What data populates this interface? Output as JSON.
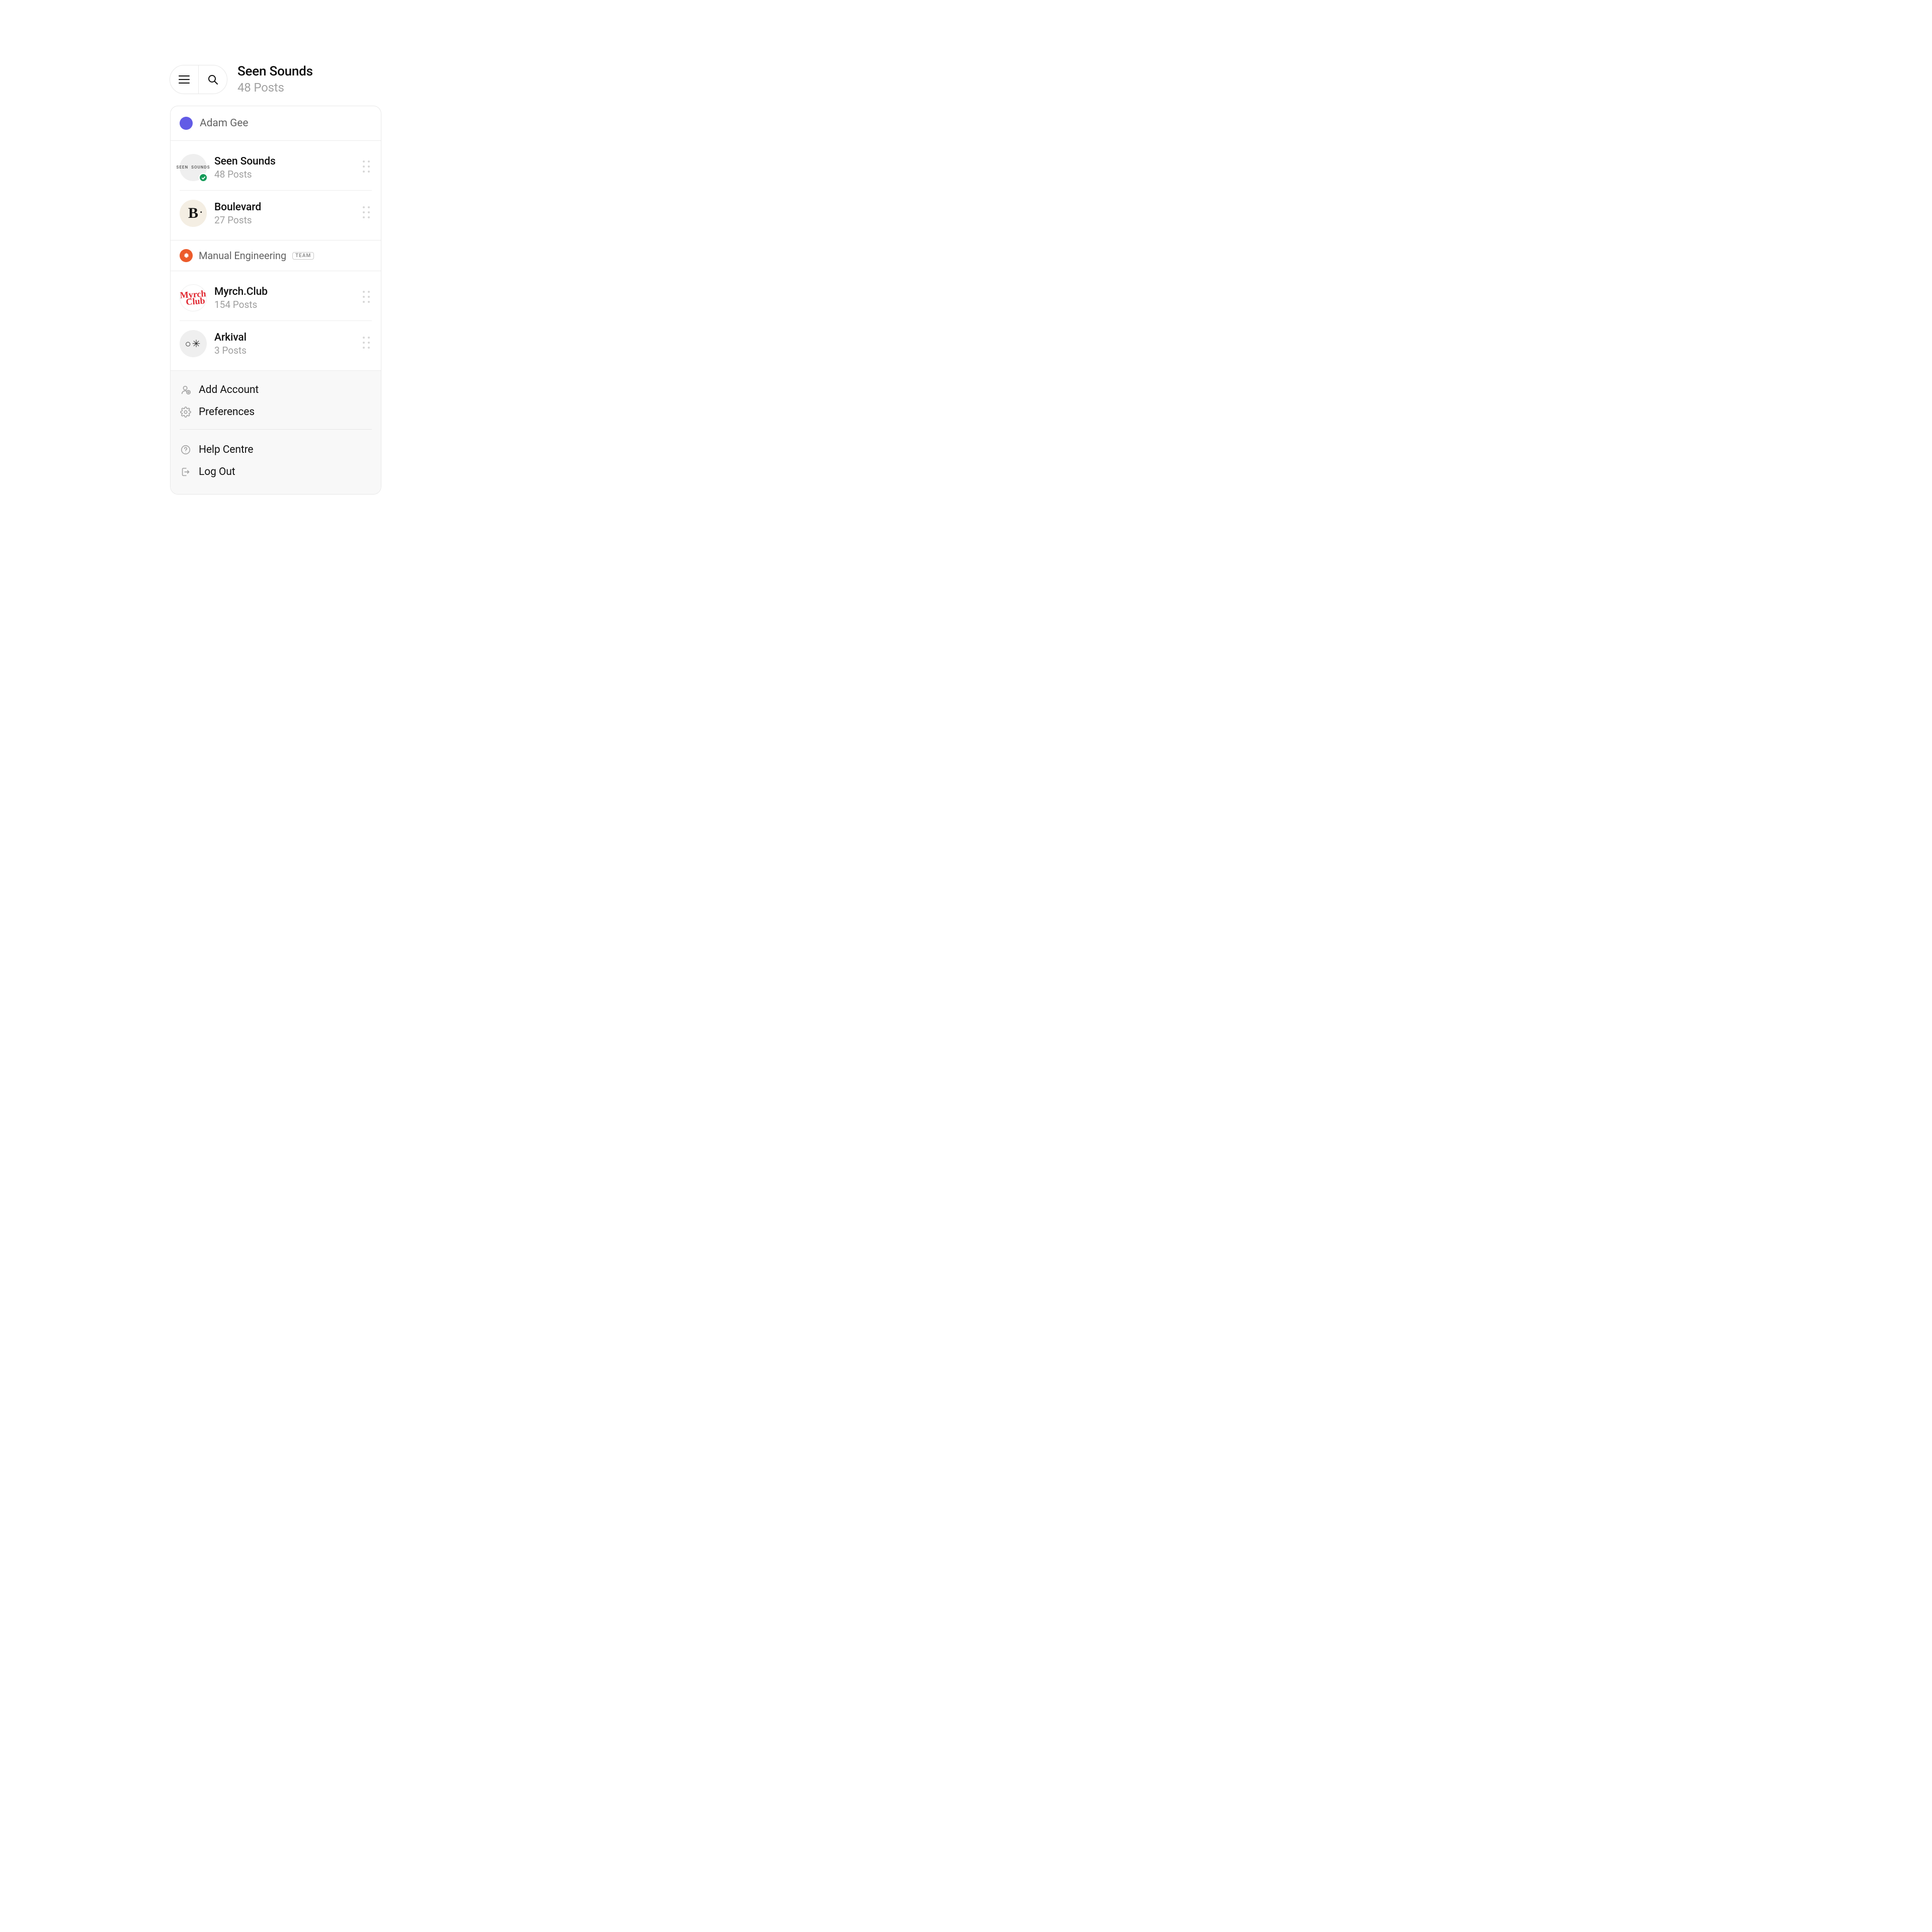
{
  "header": {
    "title": "Seen Sounds",
    "subtitle": "48 Posts"
  },
  "owner": {
    "name": "Adam Gee",
    "avatar_color": "#625be6"
  },
  "personal_accounts": [
    {
      "id": "seen-sounds",
      "name": "Seen Sounds",
      "posts_label": "48 Posts",
      "avatar_style": "seen",
      "avatar_text": "SEEN  SOUNDS",
      "active": true
    },
    {
      "id": "boulevard",
      "name": "Boulevard",
      "posts_label": "27 Posts",
      "avatar_style": "blvd",
      "avatar_text": "B",
      "active": false
    }
  ],
  "team": {
    "name": "Manual Engineering",
    "badge": "TEAM",
    "avatar_color": "#ec5b2b",
    "accounts": [
      {
        "id": "myrch-club",
        "name": "Myrch.Club",
        "posts_label": "154 Posts",
        "avatar_style": "myrch",
        "avatar_text": "Myrch\nClub"
      },
      {
        "id": "arkival",
        "name": "Arkival",
        "posts_label": "3 Posts",
        "avatar_style": "arkival",
        "avatar_text": "○✳"
      }
    ]
  },
  "footer": {
    "primary": [
      {
        "id": "add-account",
        "label": "Add Account",
        "icon": "user-plus-icon"
      },
      {
        "id": "preferences",
        "label": "Preferences",
        "icon": "gear-icon"
      }
    ],
    "secondary": [
      {
        "id": "help-centre",
        "label": "Help Centre",
        "icon": "help-icon"
      },
      {
        "id": "log-out",
        "label": "Log Out",
        "icon": "logout-icon"
      }
    ]
  }
}
